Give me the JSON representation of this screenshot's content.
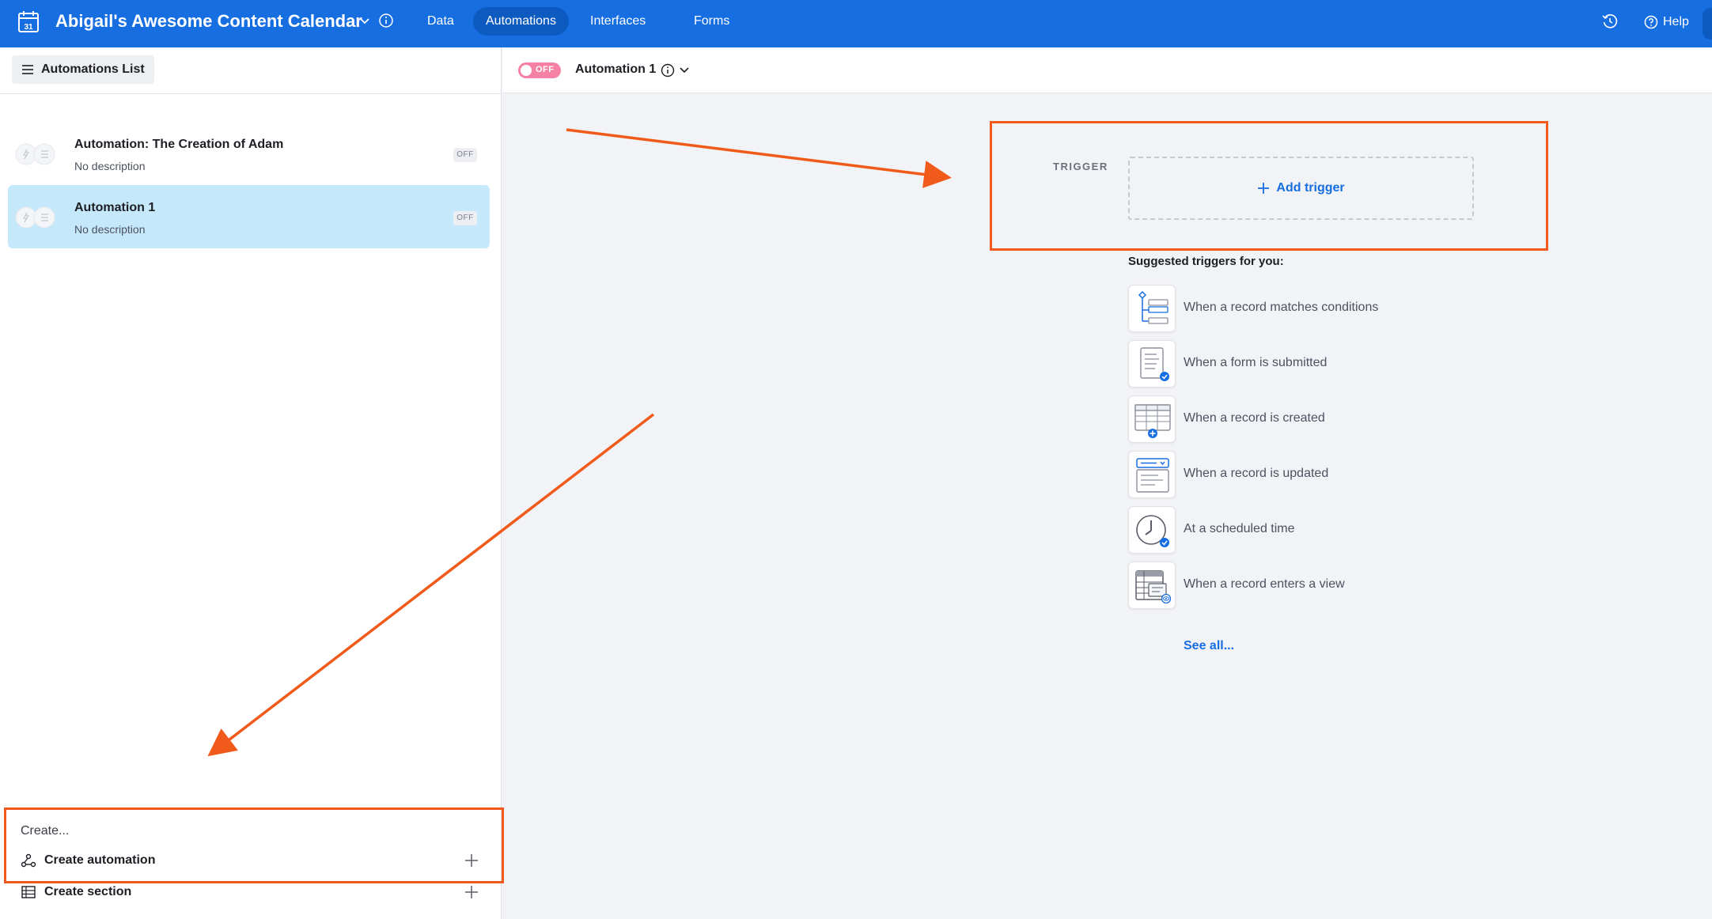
{
  "app": {
    "title": "Abigail's Awesome Content Calendar",
    "calendar_day": "31",
    "nav_tabs": [
      {
        "label": "Data"
      },
      {
        "label": "Automations"
      },
      {
        "label": "Interfaces"
      },
      {
        "label": "Forms"
      }
    ],
    "help_label": "Help"
  },
  "sidebar": {
    "list_button_label": "Automations List",
    "automations": [
      {
        "title": "Automation: The Creation of Adam",
        "description": "No description",
        "status": "OFF"
      },
      {
        "title": "Automation 1",
        "description": "No description",
        "status": "OFF"
      }
    ],
    "create": {
      "label": "Create...",
      "automation_label": "Create automation",
      "section_label": "Create section"
    }
  },
  "main": {
    "toggle_label": "OFF",
    "automation_name": "Automation 1",
    "trigger": {
      "label": "TRIGGER",
      "add_label": "Add trigger"
    },
    "suggested_title": "Suggested triggers for you:",
    "suggested_triggers": [
      {
        "label": "When a record matches conditions",
        "icon": "conditions-icon"
      },
      {
        "label": "When a form is submitted",
        "icon": "form-submitted-icon"
      },
      {
        "label": "When a record is created",
        "icon": "record-created-icon"
      },
      {
        "label": "When a record is updated",
        "icon": "record-updated-icon"
      },
      {
        "label": "At a scheduled time",
        "icon": "clock-icon"
      },
      {
        "label": "When a record enters a view",
        "icon": "record-view-icon"
      }
    ],
    "see_all_label": "See all..."
  },
  "colors": {
    "brand_blue": "#176ee1",
    "selected_item": "#c5e8fa",
    "toggle_off": "#f582a4",
    "annotation_orange": "#f05a1a"
  }
}
